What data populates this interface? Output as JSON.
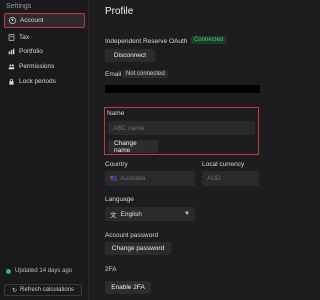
{
  "sidebar": {
    "title": "Settings",
    "items": [
      {
        "label": "Account",
        "icon": "person-icon",
        "active": true
      },
      {
        "label": "Tax",
        "icon": "tax-icon",
        "active": false
      },
      {
        "label": "Portfolio",
        "icon": "portfolio-icon",
        "active": false
      },
      {
        "label": "Permissions",
        "icon": "people-icon",
        "active": false
      },
      {
        "label": "Lock periods",
        "icon": "lock-icon",
        "active": false
      }
    ],
    "updated": "Updated 14 days ago",
    "refresh_label": "Refresh calculations"
  },
  "main": {
    "title": "Profile",
    "oauth": {
      "label": "Independent Reserve OAuth",
      "status": "Connected",
      "disconnect_label": "Disconnect"
    },
    "email": {
      "label": "Email",
      "status": "Not connected"
    },
    "name": {
      "label": "Name",
      "placeholder": "ABC name",
      "button": "Change name"
    },
    "country": {
      "label": "Country",
      "value": "Australia"
    },
    "currency": {
      "label": "Local currency",
      "value": "AUD"
    },
    "language": {
      "label": "Language",
      "value": "English"
    },
    "password": {
      "label": "Account password",
      "button": "Change password"
    },
    "twofa": {
      "label": "2FA",
      "button": "Enable 2FA"
    }
  },
  "colors": {
    "accent_red": "#c33a3a",
    "connected_green": "#3ecf7a",
    "bg": "#1d1d1f"
  }
}
